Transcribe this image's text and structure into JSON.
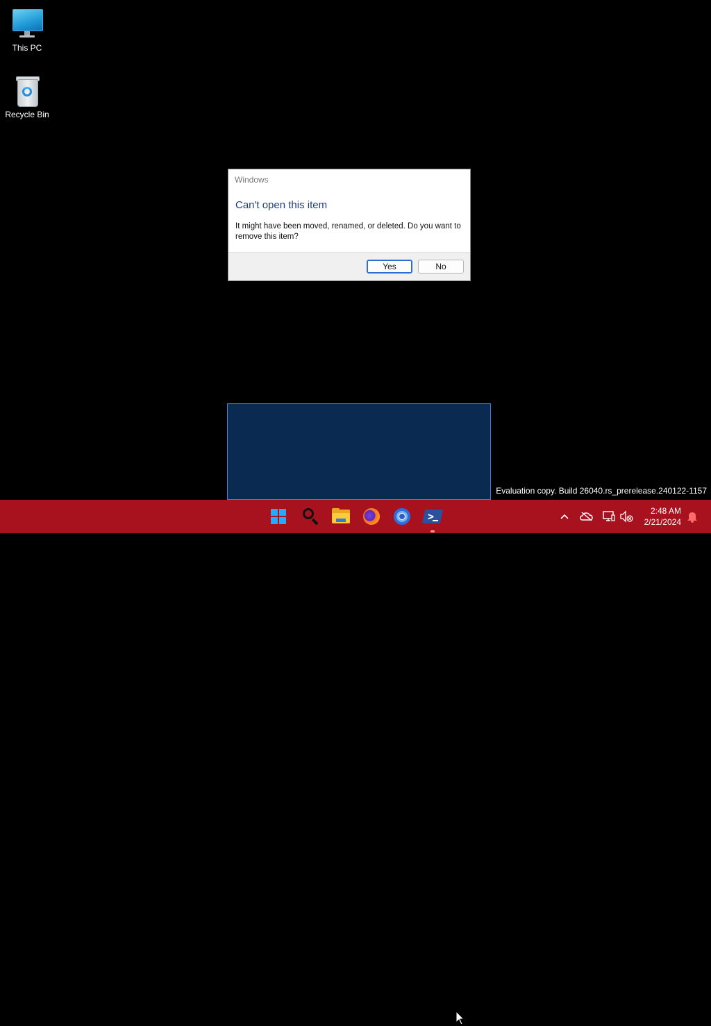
{
  "desktop": {
    "icons": [
      {
        "label": "This PC",
        "icon": "computer-icon"
      },
      {
        "label": "Recycle Bin",
        "icon": "recycle-bin-icon"
      }
    ]
  },
  "dialog": {
    "title": "Windows",
    "heading": "Can't open this item",
    "message": "It might have been moved, renamed, or deleted. Do you want to remove this item?",
    "yes_label": "Yes",
    "no_label": "No",
    "default_button": "Yes"
  },
  "watermark": "Evaluation copy. Build 26040.rs_prerelease.240122-1157",
  "taskbar": {
    "color": "#a8111e",
    "pinned": [
      {
        "icon": "start-windows-icon"
      },
      {
        "icon": "search-icon"
      },
      {
        "icon": "file-explorer-icon"
      },
      {
        "icon": "firefox-icon"
      },
      {
        "icon": "chrome-icon"
      },
      {
        "icon": "powershell-icon",
        "running": true
      }
    ],
    "tray": {
      "icons": [
        "chevron-up-icon",
        "onedrive-offline-icon",
        "network-icon",
        "volume-muted-icon",
        "notification-bell-icon"
      ],
      "time": "2:48 AM",
      "date": "2/21/2024"
    }
  },
  "colors": {
    "accent_blue": "#29a8ff",
    "dialog_heading": "#1f3a8a",
    "selection_fill": "#0b2a52",
    "selection_border": "#3d7fd6"
  }
}
